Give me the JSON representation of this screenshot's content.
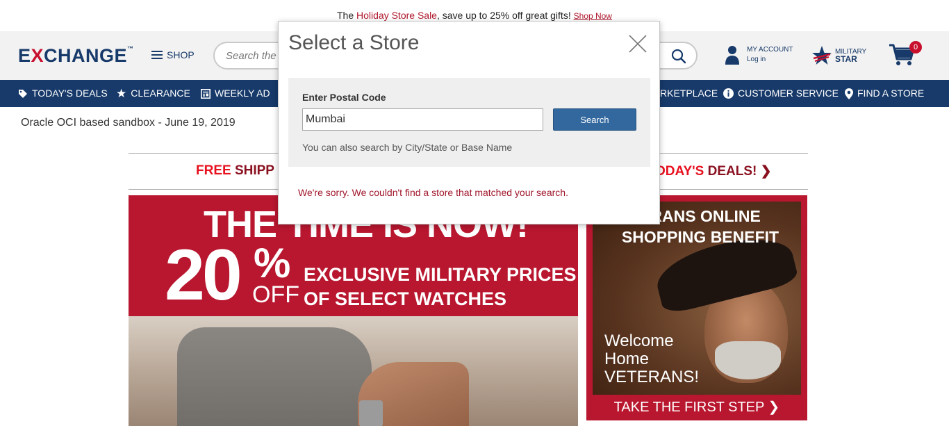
{
  "promo": {
    "prefix": "The ",
    "highlight": "Holiday Store Sale",
    "suffix": ", save up to 25% off great gifts!",
    "link": "Shop Now"
  },
  "header": {
    "logo_pre": "E",
    "logo_x": "X",
    "logo_post": "CHANGE",
    "logo_tm": "™",
    "shop_label": "SHOP",
    "search_placeholder": "Search the",
    "account_title": "MY ACCOUNT",
    "account_sub": "Log in",
    "military_line1": "MILITARY",
    "military_line2": "STAR",
    "cart_count": "0"
  },
  "nav": {
    "items": [
      {
        "label": "TODAY'S DEALS",
        "icon": "tag-icon"
      },
      {
        "label": "CLEARANCE",
        "icon": "star-icon"
      },
      {
        "label": "WEEKLY AD",
        "icon": "newspaper-icon"
      },
      {
        "label": "RKETPLACE",
        "icon": ""
      },
      {
        "label": "CUSTOMER SERVICE",
        "icon": "info-icon"
      },
      {
        "label": "FIND A STORE",
        "icon": "location-pin-icon"
      }
    ]
  },
  "sandbox_text": "Oracle OCI based sandbox - June 19, 2019",
  "strip": {
    "free_red": "FREE",
    "free_rest": " SHIPP",
    "deals_red": "ODAY'S",
    "deals_rest": " DEALS! ❯"
  },
  "banner_left": {
    "title": "THE TIME IS NOW!",
    "percent": "20",
    "percent_sym": "%",
    "off": "OFF",
    "line1": "EXCLUSIVE MILITARY PRICES",
    "line2": "OF SELECT WATCHES"
  },
  "banner_right": {
    "title1": "ERANS ONLINE",
    "title2": "SHOPPING BENEFIT",
    "welcome1": "Welcome",
    "welcome2": "Home",
    "welcome3": "VETERANS!",
    "cta": "TAKE THE FIRST STEP ❯"
  },
  "modal": {
    "title": "Select a Store",
    "postal_label": "Enter Postal Code",
    "postal_value": "Mumbai",
    "search_button": "Search",
    "hint": "You can also search by City/State or Base Name",
    "error": "We're sorry. We couldn't find a store that matched your search."
  },
  "colors": {
    "navy": "#173a6a",
    "brand_red": "#c8102e",
    "button_blue": "#33689e",
    "error_red": "#a0162b"
  }
}
